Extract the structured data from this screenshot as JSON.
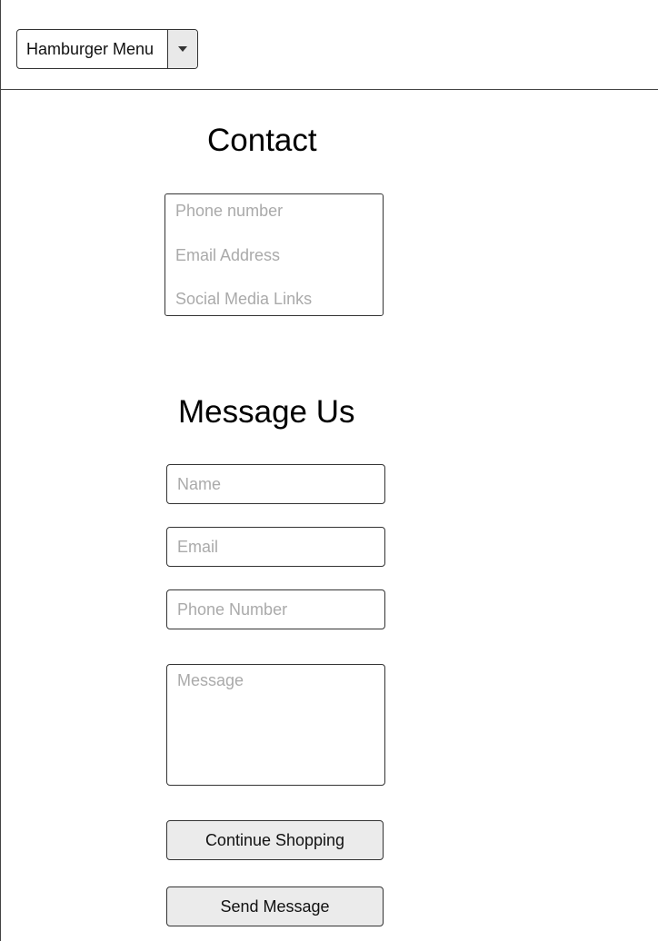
{
  "header": {
    "menu_label": "Hamburger Menu"
  },
  "contact": {
    "title": "Contact",
    "phone": "Phone number",
    "email": "Email Address",
    "social": "Social Media Links"
  },
  "message_form": {
    "title": "Message Us",
    "name_placeholder": "Name",
    "email_placeholder": "Email",
    "phone_placeholder": "Phone Number",
    "message_placeholder": "Message",
    "continue_label": "Continue Shopping",
    "send_label": "Send Message"
  },
  "icons": {
    "dropdown": "chevron-down-icon"
  },
  "colors": {
    "border": "#333333",
    "placeholder": "#aaaaaa",
    "button_bg": "#ebebeb",
    "toggle_bg": "#e9e9e9"
  }
}
